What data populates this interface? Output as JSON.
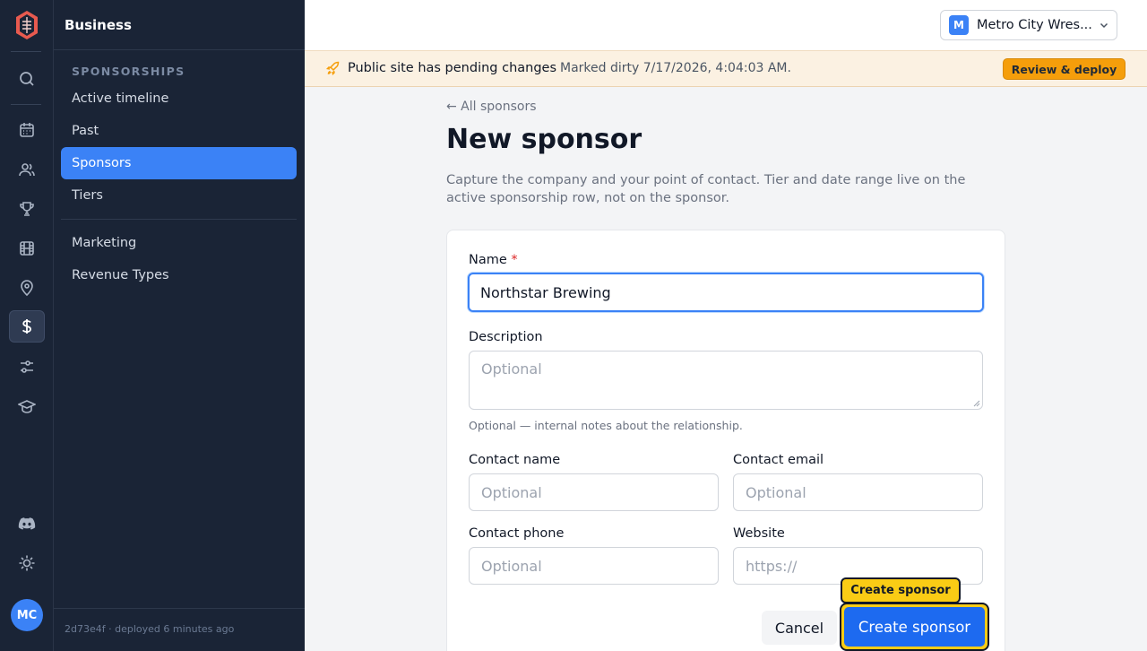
{
  "sidebar": {
    "title": "Business",
    "section_label": "SPONSORSHIPS",
    "items": [
      {
        "label": "Active timeline"
      },
      {
        "label": "Past"
      },
      {
        "label": "Sponsors"
      },
      {
        "label": "Tiers"
      },
      {
        "label": "Marketing"
      },
      {
        "label": "Revenue Types"
      }
    ],
    "footer": "2d73e4f · deployed 6 minutes ago"
  },
  "rail": {
    "avatar_initials": "MC",
    "icons": [
      "app-logo-icon",
      "search-icon",
      "calendar-icon",
      "users-icon",
      "trophy-icon",
      "film-icon",
      "map-pin-icon",
      "dollar-icon",
      "sliders-icon",
      "graduation-cap-icon",
      "discord-icon",
      "settings-icon"
    ]
  },
  "topbar": {
    "org_badge": "M",
    "org_name": "Metro City Wres..."
  },
  "banner": {
    "message": "Public site has pending changes",
    "meta": "Marked dirty 7/17/2026, 4:04:03 AM.",
    "deploy_label": "Review & deploy"
  },
  "page": {
    "back_link": "← All sponsors",
    "title": "New sponsor",
    "subtitle": "Capture the company and your point of contact. Tier and date range live on the active sponsorship row, not on the sponsor."
  },
  "form": {
    "name": {
      "label": "Name",
      "required_mark": "*",
      "value": "Northstar Brewing"
    },
    "description": {
      "label": "Description",
      "placeholder": "Optional",
      "help": "Optional — internal notes about the relationship."
    },
    "contact_name": {
      "label": "Contact name",
      "placeholder": "Optional"
    },
    "contact_email": {
      "label": "Contact email",
      "placeholder": "Optional"
    },
    "contact_phone": {
      "label": "Contact phone",
      "placeholder": "Optional"
    },
    "website": {
      "label": "Website",
      "placeholder": "https://"
    }
  },
  "actions": {
    "cancel_label": "Cancel",
    "create_label": "Create sponsor",
    "tooltip": "Create sponsor"
  },
  "colors": {
    "accent": "#3b82f6",
    "sidebar_bg": "#1a2436",
    "banner_bg": "#fbf1e2",
    "deploy_button": "#f59e0b",
    "highlight": "#facc15"
  }
}
